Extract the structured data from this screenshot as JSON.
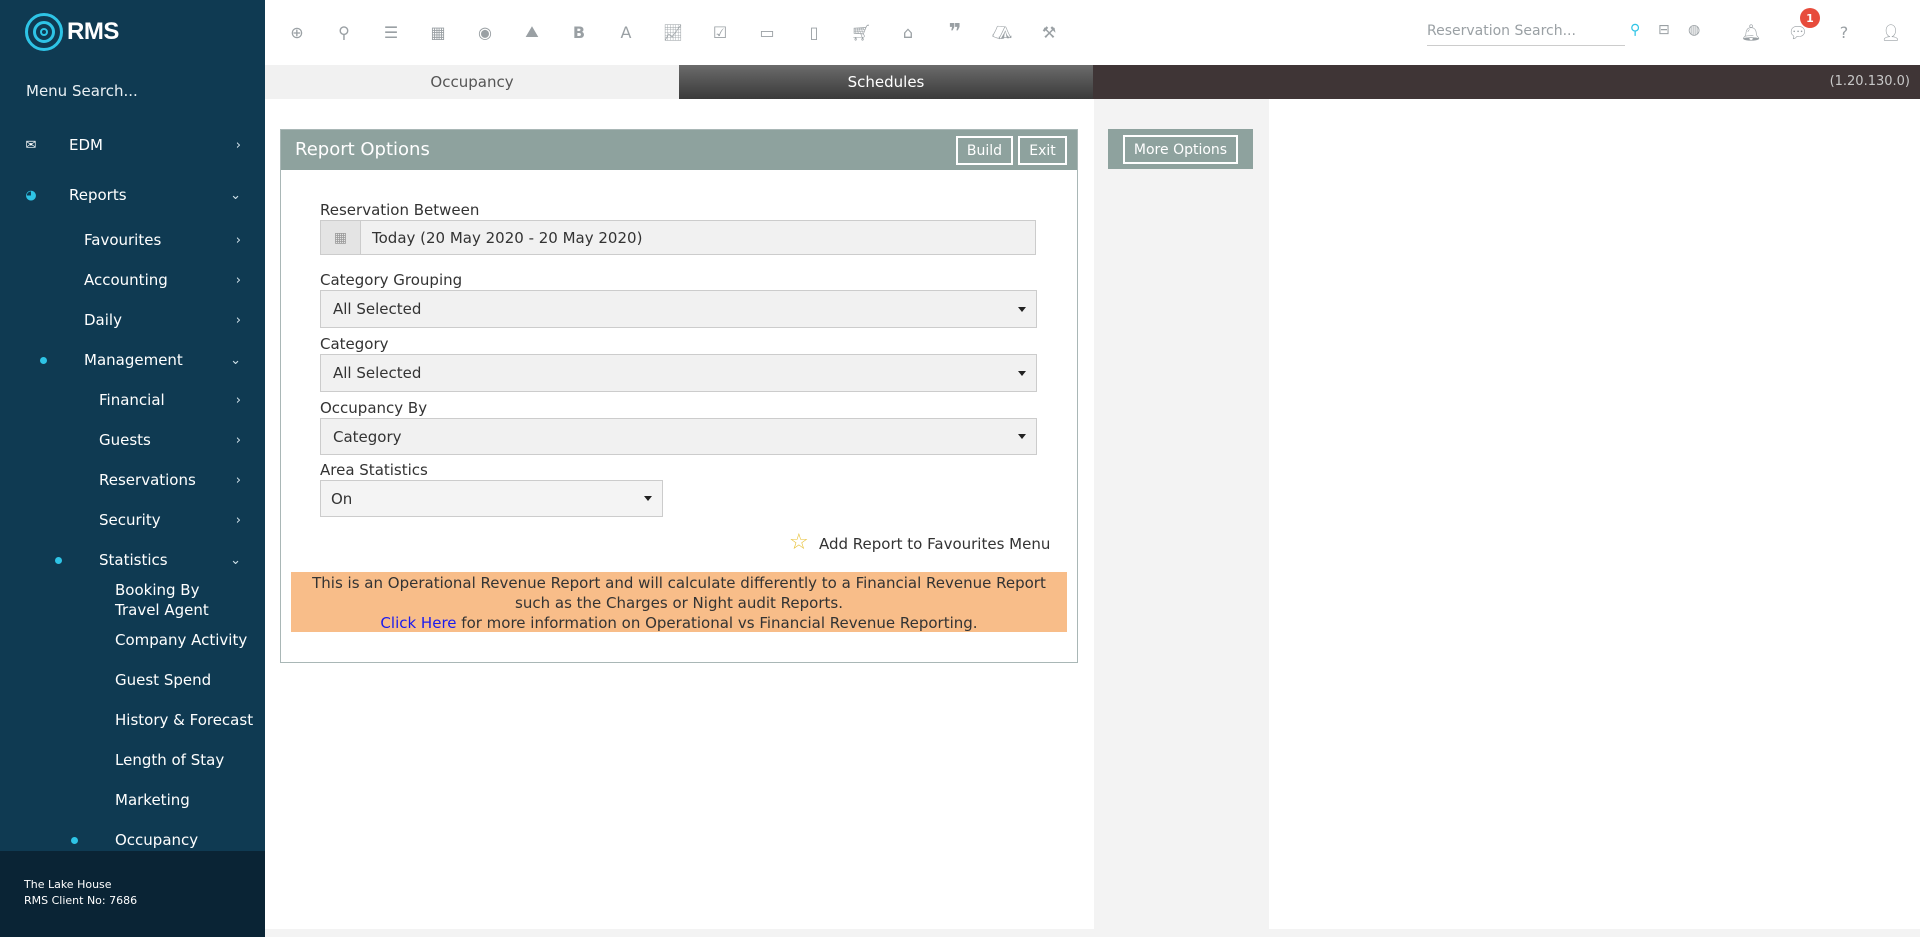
{
  "brand": {
    "name": "RMS"
  },
  "sidebar": {
    "menu_search": "Menu Search...",
    "items": [
      {
        "label": "EDM",
        "icon": "envelope-icon"
      },
      {
        "label": "Reports",
        "icon": "pie-chart-icon"
      },
      {
        "label": "Favourites"
      },
      {
        "label": "Accounting"
      },
      {
        "label": "Daily"
      },
      {
        "label": "Management"
      },
      {
        "label": "Financial"
      },
      {
        "label": "Guests"
      },
      {
        "label": "Reservations"
      },
      {
        "label": "Security"
      },
      {
        "label": "Statistics"
      },
      {
        "label": "Booking By Travel Agent"
      },
      {
        "label": "Company Activity"
      },
      {
        "label": "Guest Spend"
      },
      {
        "label": "History & Forecast"
      },
      {
        "label": "Length of Stay"
      },
      {
        "label": "Marketing"
      },
      {
        "label": "Occupancy"
      }
    ],
    "footer": {
      "property": "The Lake House",
      "client_no": "RMS Client No: 7686"
    }
  },
  "topbar": {
    "reservation_search_placeholder": "Reservation Search...",
    "notification_count": "1",
    "toolbar_letters": {
      "bold": "B",
      "font": "A"
    }
  },
  "tabs": {
    "occupancy": "Occupancy",
    "schedules": "Schedules",
    "version": "(1.20.130.0)"
  },
  "report": {
    "title": "Report Options",
    "build_label": "Build",
    "exit_label": "Exit",
    "fields": {
      "reservation_between": {
        "label": "Reservation Between",
        "value": "Today (20 May 2020 - 20 May 2020)"
      },
      "category_grouping": {
        "label": "Category Grouping",
        "value": "All Selected"
      },
      "category": {
        "label": "Category",
        "value": "All Selected"
      },
      "occupancy_by": {
        "label": "Occupancy By",
        "value": "Category"
      },
      "area_statistics": {
        "label": "Area Statistics",
        "value": "On"
      }
    },
    "favourites_label": "Add Report to Favourites Menu",
    "notice": {
      "line1": "This is an Operational Revenue Report and will calculate differently to a Financial Revenue Report",
      "line2": "such as the Charges or Night audit Reports.",
      "link": "Click Here",
      "line3": " for more information on Operational vs Financial Revenue Reporting."
    }
  },
  "more_options_label": "More Options",
  "colors": {
    "sidebar": "#0f3a52",
    "accent": "#2ec4e6",
    "report_header": "#8ea29e",
    "notice_bg": "#f8bd89",
    "badge": "#e74c3c"
  }
}
